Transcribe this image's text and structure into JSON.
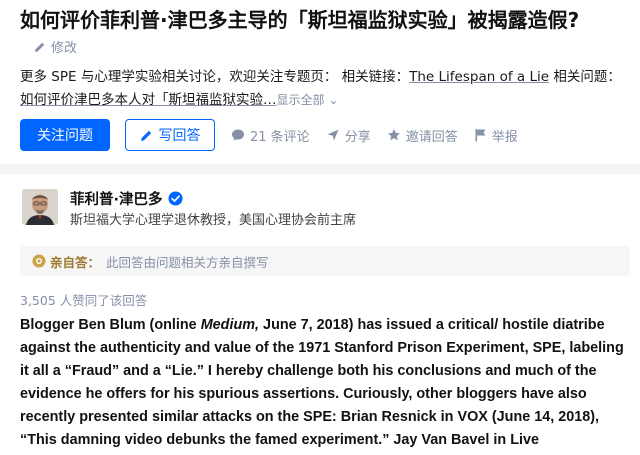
{
  "question": {
    "title": "如何评价菲利普·津巴多主导的「斯坦福监狱实验」被揭露造假?",
    "edit_label": "修改",
    "detail": {
      "prefix": "更多 SPE 与心理学实验相关讨论，欢迎关注专题页：  相关链接：",
      "link_text": "The Lifespan of a Lie",
      "middle": " 相关问题：",
      "line2": "如何评价津巴多本人对「斯坦福监狱实验…",
      "expand": "显示全部 ⌄"
    },
    "actions": {
      "follow": "关注问题",
      "write_answer": "写回答",
      "comments": "21 条评论",
      "share": "分享",
      "invite": "邀请回答",
      "report": "举报"
    }
  },
  "answer": {
    "author": {
      "name": "菲利普·津巴多",
      "bio": "斯坦福大学心理学退休教授，美国心理协会前主席"
    },
    "notice": {
      "label": "亲自答：",
      "text": "此回答由问题相关方亲自撰写"
    },
    "likes": "3,505 人赞同了该回答",
    "body": {
      "p1": "Blogger Ben Blum (online ",
      "medium": "Medium,",
      "p2": " June 7, 2018) has issued a critical/ hostile diatribe against the authenticity and value of the 1971 Stanford Prison Experiment, SPE, labeling it all a “Fraud” and a “Lie.” I hereby challenge both his conclusions and much of the evidence he offers for his spurious assertions. Curiously, other bloggers have also recently presented similar attacks on the SPE: Brian Resnick in VOX (June 14, 2018), “This damning video debunks the famed experiment.” Jay Van Bavel in Live"
    }
  },
  "colors": {
    "accent": "#0066ff",
    "muted": "#8590a6",
    "background_band": "#f4f5f7"
  },
  "icons": [
    "pencil-icon",
    "comment-icon",
    "share-icon",
    "star-icon",
    "flag-icon",
    "verified-icon",
    "badge-icon"
  ]
}
